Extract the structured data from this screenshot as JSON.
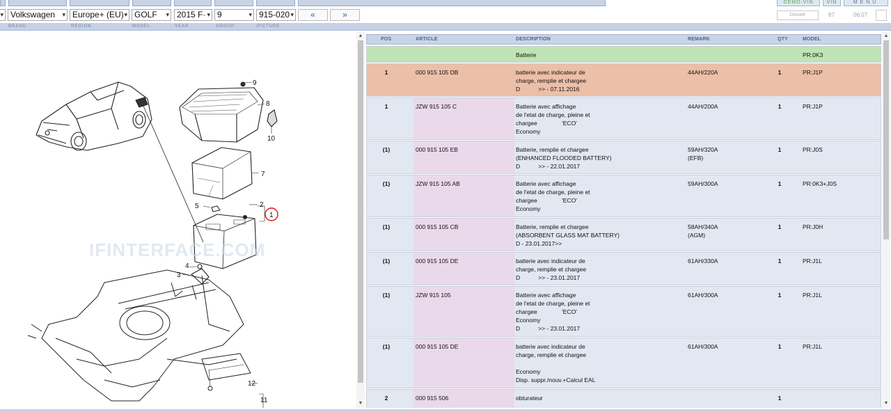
{
  "top_tabs": {
    "demo_vin": "DEMO-VIN",
    "vin": "VIN",
    "menu": "MENU"
  },
  "selectors": {
    "brand": "Volkswagen",
    "region": "Europe+ (EU)",
    "model": "GOLF",
    "year": "2015",
    "year_suffix": "F·",
    "group": "9",
    "picture": "915-020"
  },
  "nav": {
    "prev": "«",
    "next": "»"
  },
  "donate": "Donate",
  "counter_left": "87",
  "counter_right": "06:07",
  "labels": {
    "brand": "BRAND",
    "region": "REGION",
    "model": "MODEL",
    "year": "YEAR",
    "group": "GROUP",
    "picture": "PICTURE"
  },
  "diagram": {
    "watermark": "IFINTERFACE.COM",
    "callouts": [
      "9",
      "8",
      "10",
      "7",
      "5",
      "2",
      "1",
      "4",
      "3",
      "12",
      "11"
    ]
  },
  "table": {
    "headers": {
      "pos": "POS",
      "article": "ARTICLE",
      "description": "DESCRIPTION",
      "remark": "REMARK",
      "qty": "QTY",
      "model": "MODEL"
    },
    "rows": [
      {
        "style": "green",
        "pos": "",
        "article": "",
        "description": "Batterie",
        "remark": "",
        "qty": "",
        "model": "PR:0K3"
      },
      {
        "style": "orange",
        "pos": "1",
        "article": "000 915 105 DB",
        "description": "batterie avec indicateur de\ncharge, remplie et chargee\nD           >> - 07.11.2016",
        "remark": "44AH/220A",
        "qty": "1",
        "model": "PR:J1P"
      },
      {
        "style": "normal",
        "pos": "1",
        "article": "JZW 915 105 C",
        "description": "Batterie avec affichage\nde l'etat de charge, pleine et\nchargee               'ECO'\nEconomy",
        "remark": "44AH/200A",
        "qty": "1",
        "model": "PR:J1P"
      },
      {
        "style": "normal",
        "pos": "(1)",
        "article": "000 915 105 EB",
        "description": "Batterie, remplie et chargee\n(ENHANCED FLOODED BATTERY)\nD           >> - 22.01.2017",
        "remark": "59AH/320A\n(EFB)",
        "qty": "1",
        "model": "PR:J0S"
      },
      {
        "style": "normal",
        "pos": "(1)",
        "article": "JZW 915 105 AB",
        "description": "Batterie avec affichage\nde l'etat de charge, pleine et\nchargee               'ECO'\nEconomy",
        "remark": "59AH/300A",
        "qty": "1",
        "model": "PR:0K3+J0S"
      },
      {
        "style": "normal",
        "pos": "(1)",
        "article": "000 915 105 CB",
        "description": "Batterie, remplie et chargee\n(ABSORBENT GLASS MAT BATTERY)\nD - 23.01.2017>>",
        "remark": "58AH/340A\n(AGM)",
        "qty": "1",
        "model": "PR:J0H"
      },
      {
        "style": "normal",
        "pos": "(1)",
        "article": "000 915 105 DE",
        "description": "batterie avec indicateur de\ncharge, remplie et chargee\nD           >> - 23.01.2017",
        "remark": "61AH/330A",
        "qty": "1",
        "model": "PR:J1L"
      },
      {
        "style": "normal",
        "pos": "(1)",
        "article": "JZW 915 105",
        "description": "Batterie avec affichage\nde l'etat de charge, pleine et\nchargee               'ECO'\nEconomy\nD           >> - 23.01.2017",
        "remark": "61AH/300A",
        "qty": "1",
        "model": "PR:J1L"
      },
      {
        "style": "normal",
        "pos": "(1)",
        "article": "000 915 105 DE",
        "description": "batterie avec indicateur de\ncharge, remplie et chargee\n\nEconomy\nDisp. suppr./nouv.+Calcul EAL",
        "remark": "61AH/300A",
        "qty": "1",
        "model": "PR:J1L"
      },
      {
        "style": "normal",
        "pos": "2",
        "article": "000 915 506",
        "description": "obturateur",
        "remark": "",
        "qty": "1",
        "model": ""
      }
    ]
  }
}
